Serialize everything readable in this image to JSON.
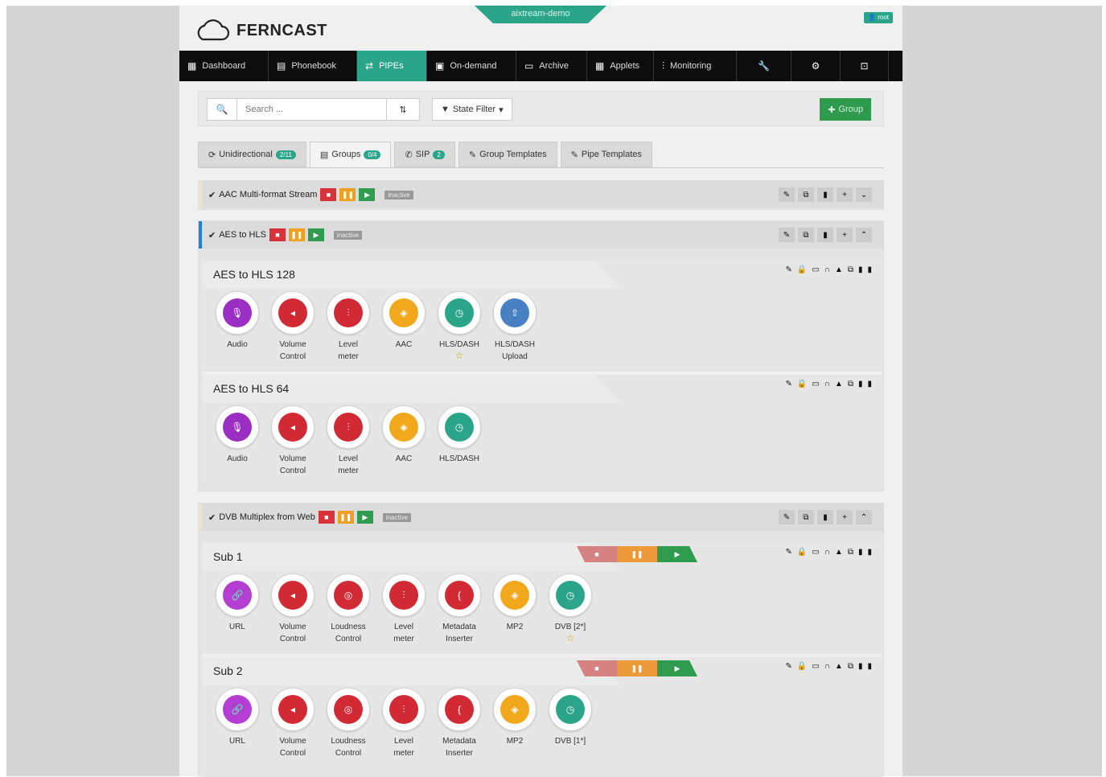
{
  "app": {
    "name": "FERNCAST",
    "environment": "aixtream-demo",
    "user": "root"
  },
  "nav": [
    {
      "label": "Dashboard",
      "icon": "dashboard-icon",
      "glyph": "▦"
    },
    {
      "label": "Phonebook",
      "icon": "phonebook-icon",
      "glyph": "▤"
    },
    {
      "label": "PIPEs",
      "icon": "pipes-icon",
      "glyph": "⇄"
    },
    {
      "label": "On-demand",
      "icon": "on-demand-icon",
      "glyph": "▣"
    },
    {
      "label": "Archive",
      "icon": "archive-icon",
      "glyph": "▭"
    },
    {
      "label": "Applets",
      "icon": "applets-icon",
      "glyph": "▦"
    },
    {
      "label": "Monitoring",
      "icon": "monitoring-icon",
      "glyph": "⫶"
    },
    {
      "label": "",
      "icon": "wrench-icon",
      "glyph": "🔧"
    },
    {
      "label": "",
      "icon": "gear-icon",
      "glyph": "⚙"
    },
    {
      "label": "",
      "icon": "logout-icon",
      "glyph": "⊡"
    }
  ],
  "toolbar": {
    "search_placeholder": "Search ...",
    "state_filter": "State Filter",
    "add_group": "Group"
  },
  "tabs": [
    {
      "label": "Unidirectional",
      "count": "2/11"
    },
    {
      "label": "Groups",
      "count": "0/4"
    },
    {
      "label": "SIP",
      "count": "2"
    },
    {
      "label": "Group Templates",
      "count": ""
    },
    {
      "label": "Pipe Templates",
      "count": ""
    }
  ],
  "groups": [
    {
      "title": "AAC Multi-format Stream",
      "status": "inactive",
      "accent": "#e8e6cf"
    },
    {
      "title": "AES to HLS",
      "status": "inactive",
      "accent": "#1e7fe0"
    },
    {
      "title": "DVB Multiplex from Web",
      "status": "inactive",
      "accent": "#e8e6cf"
    }
  ],
  "pipes": [
    {
      "title": "AES to HLS 128",
      "nodes": [
        {
          "label": "Audio",
          "label2": "",
          "color": "#9b2fc4",
          "icon": "microphone-icon",
          "glyph": "🎙",
          "star": false
        },
        {
          "label": "Volume",
          "label2": "Control",
          "color": "#d12a35",
          "icon": "volume-icon",
          "glyph": "◂",
          "star": false
        },
        {
          "label": "Level",
          "label2": "meter",
          "color": "#d12a35",
          "icon": "level-meter-icon",
          "glyph": "⫶",
          "star": false
        },
        {
          "label": "AAC",
          "label2": "",
          "color": "#f2a81c",
          "icon": "encoder-icon",
          "glyph": "◈",
          "star": false
        },
        {
          "label": "HLS/DASH",
          "label2": "",
          "color": "#2aa58a",
          "icon": "stream-icon",
          "glyph": "◷",
          "star": true
        },
        {
          "label": "HLS/DASH",
          "label2": "Upload",
          "color": "#4781c4",
          "icon": "upload-icon",
          "glyph": "⇧",
          "star": false
        }
      ]
    },
    {
      "title": "AES to HLS 64",
      "nodes": [
        {
          "label": "Audio",
          "label2": "",
          "color": "#9b2fc4",
          "icon": "microphone-icon",
          "glyph": "🎙",
          "star": false
        },
        {
          "label": "Volume",
          "label2": "Control",
          "color": "#d12a35",
          "icon": "volume-icon",
          "glyph": "◂",
          "star": false
        },
        {
          "label": "Level",
          "label2": "meter",
          "color": "#d12a35",
          "icon": "level-meter-icon",
          "glyph": "⫶",
          "star": false
        },
        {
          "label": "AAC",
          "label2": "",
          "color": "#f2a81c",
          "icon": "encoder-icon",
          "glyph": "◈",
          "star": false
        },
        {
          "label": "HLS/DASH",
          "label2": "",
          "color": "#2aa58a",
          "icon": "stream-icon",
          "glyph": "◷",
          "star": false
        }
      ]
    },
    {
      "title": "Sub 1",
      "nodes": [
        {
          "label": "URL",
          "label2": "",
          "color": "#b33ed1",
          "icon": "link-icon",
          "glyph": "🔗",
          "star": false
        },
        {
          "label": "Volume",
          "label2": "Control",
          "color": "#d12a35",
          "icon": "volume-icon",
          "glyph": "◂",
          "star": false
        },
        {
          "label": "Loudness",
          "label2": "Control",
          "color": "#d12a35",
          "icon": "loudness-icon",
          "glyph": "◎",
          "star": false
        },
        {
          "label": "Level",
          "label2": "meter",
          "color": "#d12a35",
          "icon": "level-meter-icon",
          "glyph": "⫶",
          "star": false
        },
        {
          "label": "Metadata",
          "label2": "Inserter",
          "color": "#d12a35",
          "icon": "metadata-icon",
          "glyph": "{",
          "star": false
        },
        {
          "label": "MP2",
          "label2": "",
          "color": "#f2a81c",
          "icon": "encoder-icon",
          "glyph": "◈",
          "star": false
        },
        {
          "label": "DVB [2*]",
          "label2": "",
          "color": "#2aa58a",
          "icon": "stream-icon",
          "glyph": "◷",
          "star": true
        }
      ]
    },
    {
      "title": "Sub 2",
      "nodes": [
        {
          "label": "URL",
          "label2": "",
          "color": "#b33ed1",
          "icon": "link-icon",
          "glyph": "🔗",
          "star": false
        },
        {
          "label": "Volume",
          "label2": "Control",
          "color": "#d12a35",
          "icon": "volume-icon",
          "glyph": "◂",
          "star": false
        },
        {
          "label": "Loudness",
          "label2": "Control",
          "color": "#d12a35",
          "icon": "loudness-icon",
          "glyph": "◎",
          "star": false
        },
        {
          "label": "Level",
          "label2": "meter",
          "color": "#d12a35",
          "icon": "level-meter-icon",
          "glyph": "⫶",
          "star": false
        },
        {
          "label": "Metadata",
          "label2": "Inserter",
          "color": "#d12a35",
          "icon": "metadata-icon",
          "glyph": "{",
          "star": false
        },
        {
          "label": "MP2",
          "label2": "",
          "color": "#f2a81c",
          "icon": "encoder-icon",
          "glyph": "◈",
          "star": false
        },
        {
          "label": "DVB [1*]",
          "label2": "",
          "color": "#2aa58a",
          "icon": "stream-icon",
          "glyph": "◷",
          "star": false
        }
      ]
    }
  ]
}
